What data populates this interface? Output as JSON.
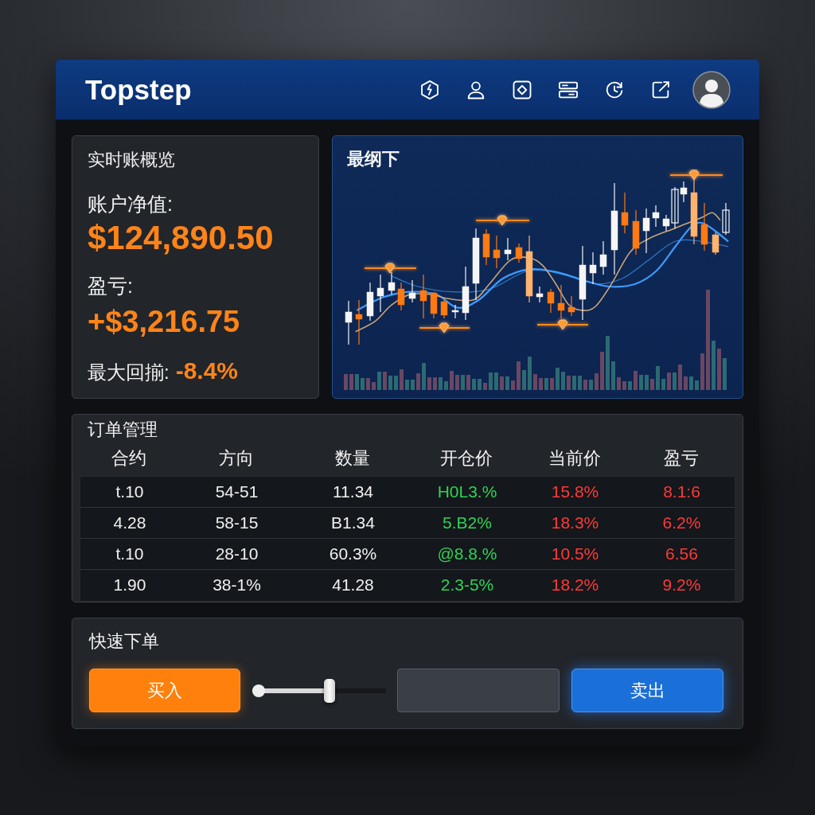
{
  "header": {
    "logo": "Topstep"
  },
  "overview": {
    "title": "实时账概览",
    "equity_label": "账户净值:",
    "equity_value": "$124,890.50",
    "pnl_label": "盈亏:",
    "pnl_value": "+$3,216.75",
    "drawdown_label": "最大回揃:",
    "drawdown_value": "-8.4%"
  },
  "chart": {
    "title": "最纲下"
  },
  "orders": {
    "title": "订单管理",
    "columns": [
      "合约",
      "方向",
      "数量",
      "开仓价",
      "当前价",
      "盈亏"
    ],
    "rows": [
      [
        "t.10",
        "54-51",
        "11.34",
        "H0L3.%",
        "15.8%",
        "8.1:6"
      ],
      [
        "4.28",
        "58-15",
        "B1.34",
        "5.B2%",
        "18.3%",
        "6.2%"
      ],
      [
        "t.10",
        "28-10",
        "60.3%",
        "@8.8.%",
        "10.5%",
        "6.56"
      ],
      [
        "1.90",
        "38-1%",
        "41.28",
        "2.3-5%",
        "18.2%",
        "9.2%"
      ]
    ]
  },
  "quick_order": {
    "title": "快速下单",
    "buy_button": "买入",
    "slider": {
      "level": 0.58
    },
    "sell_button": "卖出"
  }
}
